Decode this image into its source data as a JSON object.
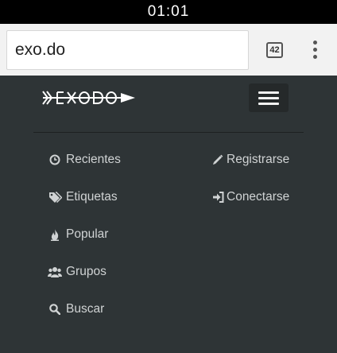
{
  "status_bar": {
    "time": "01:01"
  },
  "browser": {
    "url": "exo.do",
    "tab_count": "42"
  },
  "site": {
    "logo_text": "EXODO",
    "menu_left": [
      {
        "label": "Recientes",
        "icon": "clock-icon"
      },
      {
        "label": "Etiquetas",
        "icon": "tags-icon"
      },
      {
        "label": "Popular",
        "icon": "fire-icon"
      },
      {
        "label": "Grupos",
        "icon": "users-icon"
      },
      {
        "label": "Buscar",
        "icon": "search-icon"
      }
    ],
    "menu_right": [
      {
        "label": "Registrarse",
        "icon": "pencil-icon"
      },
      {
        "label": "Conectarse",
        "icon": "sign-in-icon"
      }
    ]
  },
  "colors": {
    "header_bg": "#2e3436",
    "link": "#d0d3d4",
    "status_bg": "#000000",
    "browser_bg": "#f2f2f2"
  }
}
